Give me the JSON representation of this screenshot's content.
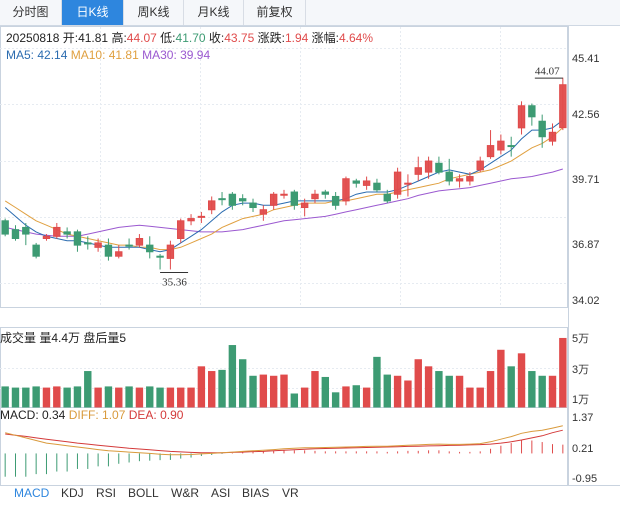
{
  "tabs": [
    {
      "label": "分时图",
      "active": false
    },
    {
      "label": "日K线",
      "active": true
    },
    {
      "label": "周K线",
      "active": false
    },
    {
      "label": "月K线",
      "active": false
    },
    {
      "label": "前复权",
      "active": false
    }
  ],
  "info": {
    "date": "20250818",
    "open_label": "开:",
    "open": "41.81",
    "high_label": "高:",
    "high": "44.07",
    "low_label": "低:",
    "low": "41.70",
    "close_label": "收:",
    "close": "43.75",
    "chg_label": "涨跌:",
    "chg": "1.94",
    "pct_label": "涨幅:",
    "pct": "4.64%"
  },
  "ma": {
    "ma5": "MA5: 42.14",
    "ma10": "MA10: 41.81",
    "ma30": "MA30: 39.94"
  },
  "price_axis": [
    "45.41",
    "42.56",
    "39.71",
    "36.87",
    "34.02"
  ],
  "high_mark": "44.07",
  "low_mark": "35.36",
  "volume": {
    "title": "成交量",
    "vol": "量4.4万",
    "after": "盘后量5",
    "axis": [
      "5万",
      "3万",
      "1万"
    ]
  },
  "macd": {
    "macd": "MACD: 0.34",
    "diff": "DIFF: 1.07",
    "dea": "DEA: 0.90",
    "axis": [
      "1.37",
      "0.21",
      "-0.95"
    ]
  },
  "bottom_tabs": [
    {
      "label": "MACD",
      "active": true
    },
    {
      "label": "KDJ",
      "active": false
    },
    {
      "label": "RSI",
      "active": false
    },
    {
      "label": "BOLL",
      "active": false
    },
    {
      "label": "W&R",
      "active": false
    },
    {
      "label": "ASI",
      "active": false
    },
    {
      "label": "BIAS",
      "active": false
    },
    {
      "label": "VR",
      "active": false
    }
  ],
  "colors": {
    "up": "#e04b4b",
    "down": "#3d9b73",
    "ma5": "#2b6cb0",
    "ma10": "#e0a040",
    "ma30": "#9b59d0",
    "diff": "#d99a3c",
    "dea": "#d43a3a",
    "accent": "#2e86de"
  },
  "chart_data": {
    "type": "candlestick",
    "ylim": [
      34.02,
      45.41
    ],
    "candles": [
      [
        37.0,
        37.6,
        37.7,
        36.9,
        "down"
      ],
      [
        36.8,
        37.2,
        37.4,
        36.7,
        "down"
      ],
      [
        37.3,
        37.0,
        37.5,
        36.5,
        "down"
      ],
      [
        36.5,
        36.0,
        36.6,
        35.9,
        "down"
      ],
      [
        36.8,
        36.9,
        37.0,
        36.7,
        "up"
      ],
      [
        36.9,
        37.3,
        37.5,
        36.8,
        "up"
      ],
      [
        37.0,
        37.1,
        37.3,
        36.8,
        "down"
      ],
      [
        37.1,
        36.5,
        37.2,
        36.2,
        "down"
      ],
      [
        36.6,
        36.6,
        36.9,
        36.3,
        "down"
      ],
      [
        36.4,
        36.6,
        36.8,
        36.2,
        "up"
      ],
      [
        36.5,
        36.0,
        36.8,
        35.8,
        "down"
      ],
      [
        36.0,
        36.2,
        36.5,
        35.9,
        "up"
      ],
      [
        36.5,
        36.5,
        36.8,
        36.3,
        "down"
      ],
      [
        36.5,
        36.8,
        37.0,
        36.4,
        "up"
      ],
      [
        36.5,
        36.2,
        36.9,
        35.9,
        "down"
      ],
      [
        36.0,
        36.0,
        36.1,
        35.4,
        "down"
      ],
      [
        35.9,
        36.5,
        36.7,
        35.4,
        "up"
      ],
      [
        36.8,
        37.6,
        37.7,
        36.6,
        "up"
      ],
      [
        37.6,
        37.7,
        37.9,
        37.4,
        "up"
      ],
      [
        37.8,
        37.8,
        38.0,
        37.5,
        "up"
      ],
      [
        38.1,
        38.5,
        38.7,
        37.9,
        "up"
      ],
      [
        38.6,
        38.6,
        38.9,
        38.3,
        "down"
      ],
      [
        38.8,
        38.3,
        38.9,
        38.1,
        "down"
      ],
      [
        38.6,
        38.5,
        38.8,
        38.3,
        "down"
      ],
      [
        38.4,
        38.2,
        38.6,
        38.0,
        "down"
      ],
      [
        37.9,
        38.1,
        38.3,
        37.6,
        "up"
      ],
      [
        38.3,
        38.8,
        38.9,
        38.1,
        "up"
      ],
      [
        38.8,
        38.8,
        39.0,
        38.6,
        "up"
      ],
      [
        38.9,
        38.3,
        39.0,
        38.1,
        "down"
      ],
      [
        38.2,
        38.4,
        38.6,
        37.8,
        "up"
      ],
      [
        38.6,
        38.8,
        39.0,
        38.4,
        "up"
      ],
      [
        38.9,
        38.8,
        39.0,
        38.6,
        "down"
      ],
      [
        38.7,
        38.3,
        38.9,
        38.1,
        "down"
      ],
      [
        38.5,
        39.5,
        39.6,
        38.3,
        "up"
      ],
      [
        39.4,
        39.3,
        39.5,
        39.1,
        "down"
      ],
      [
        39.2,
        39.4,
        39.6,
        39.0,
        "up"
      ],
      [
        39.3,
        39.0,
        39.5,
        38.9,
        "down"
      ],
      [
        38.8,
        38.5,
        39.0,
        38.4,
        "down"
      ],
      [
        38.8,
        39.8,
        40.0,
        38.6,
        "up"
      ],
      [
        39.3,
        39.3,
        39.7,
        38.7,
        "up"
      ],
      [
        39.7,
        40.0,
        40.5,
        39.4,
        "up"
      ],
      [
        39.8,
        40.3,
        40.5,
        39.5,
        "up"
      ],
      [
        40.2,
        39.8,
        40.5,
        39.7,
        "down"
      ],
      [
        39.8,
        39.4,
        40.4,
        39.2,
        "down"
      ],
      [
        39.5,
        39.4,
        39.7,
        39.1,
        "up"
      ],
      [
        39.4,
        39.6,
        39.8,
        39.2,
        "up"
      ],
      [
        39.9,
        40.3,
        40.5,
        39.8,
        "up"
      ],
      [
        40.5,
        41.0,
        41.7,
        40.4,
        "up"
      ],
      [
        40.8,
        41.2,
        41.5,
        40.6,
        "up"
      ],
      [
        41.0,
        41.0,
        41.4,
        40.5,
        "down"
      ],
      [
        41.8,
        42.8,
        43.0,
        41.5,
        "up"
      ],
      [
        42.8,
        42.3,
        42.9,
        41.9,
        "down"
      ],
      [
        42.1,
        41.4,
        42.4,
        40.9,
        "down"
      ],
      [
        41.2,
        41.6,
        42.0,
        41.0,
        "up"
      ],
      [
        41.81,
        43.75,
        44.07,
        41.7,
        "up"
      ]
    ],
    "ma5": [
      38.2,
      37.8,
      37.4,
      37.1,
      36.9,
      36.8,
      36.7,
      36.7,
      36.6,
      36.5,
      36.4,
      36.4,
      36.4,
      36.4,
      36.3,
      36.2,
      36.3,
      36.6,
      36.9,
      37.2,
      37.6,
      38.0,
      38.3,
      38.4,
      38.4,
      38.3,
      38.3,
      38.4,
      38.5,
      38.5,
      38.5,
      38.5,
      38.5,
      38.6,
      38.8,
      38.9,
      38.9,
      38.9,
      39.0,
      39.2,
      39.4,
      39.6,
      39.8,
      39.9,
      39.8,
      39.7,
      39.9,
      40.2,
      40.5,
      40.8,
      41.3,
      41.7,
      41.7,
      41.8,
      42.14
    ],
    "ma10": [
      38.5,
      38.2,
      37.9,
      37.6,
      37.4,
      37.2,
      37.0,
      36.9,
      36.8,
      36.7,
      36.6,
      36.5,
      36.5,
      36.4,
      36.4,
      36.3,
      36.3,
      36.4,
      36.6,
      36.8,
      37.0,
      37.3,
      37.5,
      37.7,
      37.8,
      37.9,
      38.1,
      38.2,
      38.3,
      38.4,
      38.4,
      38.4,
      38.5,
      38.5,
      38.6,
      38.7,
      38.8,
      38.8,
      38.9,
      39.0,
      39.1,
      39.2,
      39.3,
      39.5,
      39.6,
      39.7,
      39.8,
      39.9,
      40.1,
      40.3,
      40.6,
      40.9,
      41.1,
      41.4,
      41.81
    ],
    "ma30": [
      37.3,
      37.2,
      37.1,
      37.0,
      36.95,
      36.9,
      36.9,
      36.9,
      37.0,
      37.1,
      37.2,
      37.3,
      37.35,
      37.4,
      37.35,
      37.3,
      37.25,
      37.2,
      37.15,
      37.1,
      37.1,
      37.1,
      37.15,
      37.2,
      37.3,
      37.4,
      37.5,
      37.6,
      37.65,
      37.7,
      37.75,
      37.8,
      37.9,
      38.0,
      38.1,
      38.2,
      38.3,
      38.4,
      38.5,
      38.6,
      38.75,
      38.85,
      38.95,
      39.0,
      39.05,
      39.1,
      39.2,
      39.3,
      39.4,
      39.5,
      39.55,
      39.6,
      39.7,
      39.8,
      39.94
    ],
    "volume_ylim": [
      0,
      5.5
    ],
    "volume": [
      1.7,
      1.6,
      1.6,
      1.7,
      1.6,
      1.7,
      1.6,
      1.7,
      3.0,
      1.6,
      1.7,
      1.6,
      1.7,
      1.6,
      1.7,
      1.6,
      1.6,
      1.6,
      1.6,
      3.4,
      3.0,
      3.1,
      5.2,
      4.0,
      2.6,
      2.7,
      2.6,
      2.7,
      1.1,
      1.6,
      3.0,
      2.5,
      1.2,
      1.7,
      1.8,
      1.6,
      4.2,
      2.7,
      2.6,
      2.2,
      4.0,
      3.4,
      3.0,
      2.6,
      2.6,
      1.6,
      1.6,
      3.0,
      4.8,
      3.4,
      4.5,
      3.0,
      2.6,
      2.6,
      5.8
    ],
    "macd_ylim": [
      -0.95,
      1.37
    ],
    "diff": [
      0.8,
      0.7,
      0.6,
      0.5,
      0.4,
      0.35,
      0.3,
      0.25,
      0.2,
      0.15,
      0.1,
      0.08,
      0.05,
      0.03,
      0.0,
      -0.03,
      -0.05,
      -0.05,
      -0.04,
      -0.02,
      0.0,
      0.03,
      0.05,
      0.08,
      0.1,
      0.12,
      0.15,
      0.18,
      0.2,
      0.22,
      0.22,
      0.23,
      0.24,
      0.25,
      0.26,
      0.27,
      0.28,
      0.28,
      0.3,
      0.32,
      0.33,
      0.35,
      0.36,
      0.35,
      0.35,
      0.36,
      0.38,
      0.45,
      0.55,
      0.65,
      0.78,
      0.85,
      0.9,
      0.98,
      1.07
    ],
    "dea": [
      0.75,
      0.7,
      0.66,
      0.6,
      0.55,
      0.5,
      0.45,
      0.4,
      0.36,
      0.32,
      0.28,
      0.24,
      0.2,
      0.17,
      0.14,
      0.11,
      0.08,
      0.06,
      0.04,
      0.03,
      0.03,
      0.03,
      0.04,
      0.05,
      0.07,
      0.08,
      0.1,
      0.12,
      0.14,
      0.16,
      0.18,
      0.19,
      0.2,
      0.21,
      0.22,
      0.23,
      0.24,
      0.25,
      0.26,
      0.27,
      0.28,
      0.29,
      0.3,
      0.31,
      0.32,
      0.33,
      0.34,
      0.36,
      0.4,
      0.45,
      0.52,
      0.6,
      0.68,
      0.8,
      0.9
    ],
    "macd_hist": [
      -0.9,
      -0.9,
      -0.9,
      -0.8,
      -0.8,
      -0.7,
      -0.7,
      -0.6,
      -0.6,
      -0.5,
      -0.5,
      -0.4,
      -0.35,
      -0.3,
      -0.28,
      -0.26,
      -0.25,
      -0.2,
      -0.16,
      -0.1,
      -0.06,
      -0.02,
      0.02,
      0.05,
      0.06,
      0.08,
      0.1,
      0.12,
      0.12,
      0.12,
      0.1,
      0.08,
      0.08,
      0.08,
      0.08,
      0.08,
      0.08,
      0.06,
      0.08,
      0.1,
      0.1,
      0.12,
      0.12,
      0.08,
      0.06,
      0.06,
      0.08,
      0.18,
      0.3,
      0.4,
      0.52,
      0.5,
      0.44,
      0.36,
      0.34
    ]
  }
}
